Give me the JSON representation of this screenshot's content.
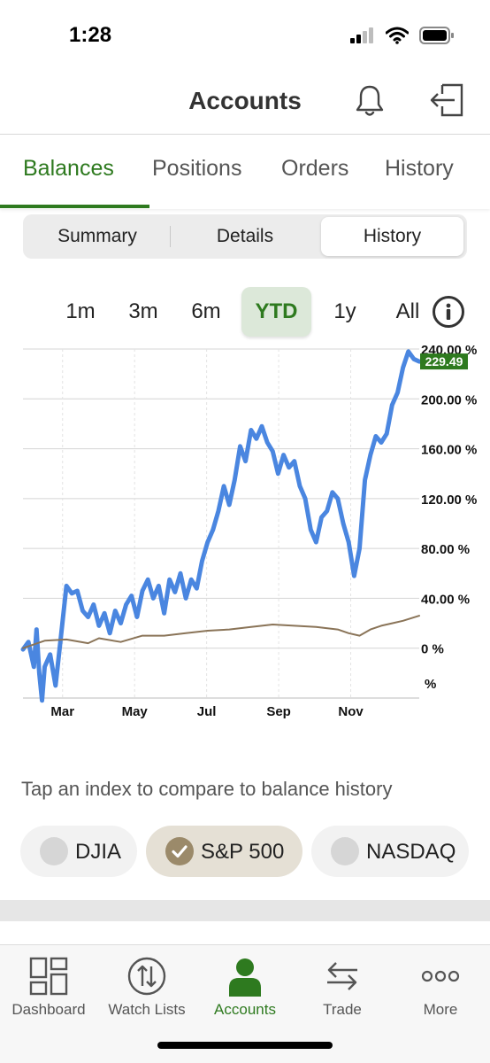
{
  "status": {
    "time": "1:28"
  },
  "header": {
    "title": "Accounts"
  },
  "main_tabs": [
    {
      "label": "Balances",
      "active": true
    },
    {
      "label": "Positions",
      "active": false
    },
    {
      "label": "Orders",
      "active": false
    },
    {
      "label": "History",
      "active": false
    }
  ],
  "sub_tabs": [
    {
      "label": "Summary",
      "active": false
    },
    {
      "label": "Details",
      "active": false
    },
    {
      "label": "History",
      "active": true
    }
  ],
  "ranges": [
    {
      "label": "1m",
      "active": false
    },
    {
      "label": "3m",
      "active": false
    },
    {
      "label": "6m",
      "active": false
    },
    {
      "label": "YTD",
      "active": true
    },
    {
      "label": "1y",
      "active": false
    },
    {
      "label": "All",
      "active": false
    }
  ],
  "colors": {
    "accent": "#2e7a1f",
    "balance_line": "#4a86e0",
    "index_line": "#8a7458",
    "grid": "#d4d4d4"
  },
  "chart_data": {
    "type": "line",
    "x_ticks": [
      "Mar",
      "May",
      "Jul",
      "Sep",
      "Nov"
    ],
    "y_ticks": [
      {
        "value": 0,
        "label": "0 %"
      },
      {
        "value": 40,
        "label": "40.00 %"
      },
      {
        "value": 80,
        "label": "80.00 %"
      },
      {
        "value": 120,
        "label": "120.00 %"
      },
      {
        "value": 160,
        "label": "160.00 %"
      },
      {
        "value": 200,
        "label": "200.00 %"
      },
      {
        "value": 240,
        "label": "240.00 %"
      }
    ],
    "bottom_label": "%",
    "ylim": [
      -40,
      240
    ],
    "current_value_label": "229.49",
    "series": [
      {
        "role": "balance",
        "points": [
          [
            0,
            -1
          ],
          [
            1,
            5
          ],
          [
            2,
            -15
          ],
          [
            2.5,
            15
          ],
          [
            3,
            -20
          ],
          [
            3.5,
            -42
          ],
          [
            4,
            -15
          ],
          [
            5,
            -5
          ],
          [
            6,
            -30
          ],
          [
            7,
            10
          ],
          [
            8,
            50
          ],
          [
            9,
            44
          ],
          [
            10,
            46
          ],
          [
            11,
            30
          ],
          [
            12,
            25
          ],
          [
            13,
            35
          ],
          [
            14,
            18
          ],
          [
            15,
            28
          ],
          [
            16,
            12
          ],
          [
            17,
            30
          ],
          [
            18,
            20
          ],
          [
            19,
            35
          ],
          [
            20,
            42
          ],
          [
            21,
            25
          ],
          [
            22,
            46
          ],
          [
            23,
            55
          ],
          [
            24,
            40
          ],
          [
            25,
            50
          ],
          [
            26,
            28
          ],
          [
            27,
            55
          ],
          [
            28,
            45
          ],
          [
            29,
            60
          ],
          [
            30,
            40
          ],
          [
            31,
            55
          ],
          [
            32,
            48
          ],
          [
            33,
            70
          ],
          [
            34,
            85
          ],
          [
            35,
            95
          ],
          [
            36,
            110
          ],
          [
            37,
            130
          ],
          [
            38,
            115
          ],
          [
            39,
            135
          ],
          [
            40,
            162
          ],
          [
            41,
            150
          ],
          [
            42,
            175
          ],
          [
            43,
            168
          ],
          [
            44,
            178
          ],
          [
            45,
            165
          ],
          [
            46,
            158
          ],
          [
            47,
            140
          ],
          [
            48,
            155
          ],
          [
            49,
            145
          ],
          [
            50,
            150
          ],
          [
            51,
            130
          ],
          [
            52,
            120
          ],
          [
            53,
            95
          ],
          [
            54,
            85
          ],
          [
            55,
            105
          ],
          [
            56,
            110
          ],
          [
            57,
            125
          ],
          [
            58,
            120
          ],
          [
            59,
            100
          ],
          [
            60,
            85
          ],
          [
            61,
            58
          ],
          [
            62,
            80
          ],
          [
            63,
            135
          ],
          [
            64,
            155
          ],
          [
            65,
            170
          ],
          [
            66,
            165
          ],
          [
            67,
            172
          ],
          [
            68,
            195
          ],
          [
            69,
            205
          ],
          [
            70,
            225
          ],
          [
            71,
            238
          ],
          [
            72,
            232
          ],
          [
            73,
            230
          ]
        ]
      },
      {
        "role": "index",
        "points": [
          [
            0,
            0
          ],
          [
            4,
            6
          ],
          [
            8,
            7
          ],
          [
            12,
            4
          ],
          [
            14,
            8
          ],
          [
            18,
            5
          ],
          [
            22,
            10
          ],
          [
            26,
            10
          ],
          [
            30,
            12
          ],
          [
            34,
            14
          ],
          [
            38,
            15
          ],
          [
            42,
            17
          ],
          [
            46,
            19
          ],
          [
            50,
            18
          ],
          [
            54,
            17
          ],
          [
            58,
            15
          ],
          [
            60,
            12
          ],
          [
            62,
            10
          ],
          [
            64,
            15
          ],
          [
            66,
            18
          ],
          [
            68,
            20
          ],
          [
            70,
            22
          ],
          [
            73,
            26
          ]
        ]
      }
    ]
  },
  "compare": {
    "hint": "Tap an index to compare to balance history",
    "indices": [
      {
        "label": "DJIA",
        "selected": false
      },
      {
        "label": "S&P 500",
        "selected": true
      },
      {
        "label": "NASDAQ",
        "selected": false
      }
    ]
  },
  "bottom_nav": [
    {
      "label": "Dashboard",
      "icon": "dashboard-icon",
      "active": false
    },
    {
      "label": "Watch Lists",
      "icon": "watch-lists-icon",
      "active": false
    },
    {
      "label": "Accounts",
      "icon": "accounts-icon",
      "active": true
    },
    {
      "label": "Trade",
      "icon": "trade-icon",
      "active": false
    },
    {
      "label": "More",
      "icon": "more-icon",
      "active": false
    }
  ]
}
